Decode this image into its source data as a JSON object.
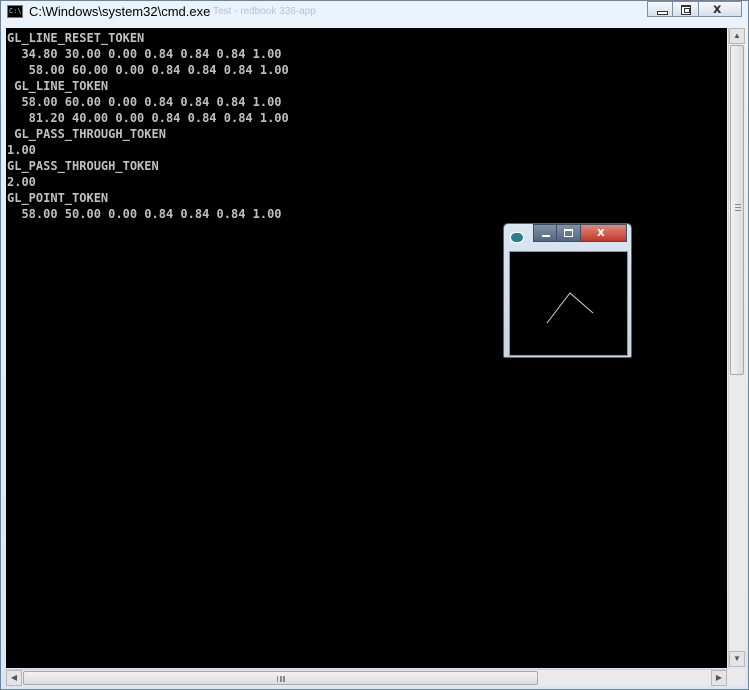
{
  "window": {
    "title": "C:\\Windows\\system32\\cmd.exe",
    "icon_text": "C:\\",
    "background_title": "Test - redbook 336-app"
  },
  "console": {
    "text_color": "#c0c0c0",
    "background": "#000000",
    "lines": [
      "GL_LINE_RESET_TOKEN",
      "  34.80 30.00 0.00 0.84 0.84 0.84 1.00",
      "   58.00 60.00 0.00 0.84 0.84 0.84 1.00",
      " GL_LINE_TOKEN",
      "  58.00 60.00 0.00 0.84 0.84 0.84 1.00",
      "   81.20 40.00 0.00 0.84 0.84 0.84 1.00",
      " GL_PASS_THROUGH_TOKEN",
      "1.00",
      "GL_PASS_THROUGH_TOKEN",
      "2.00",
      "GL_POINT_TOKEN",
      "  58.00 50.00 0.00 0.84 0.84 0.84 1.00"
    ]
  },
  "icons": {
    "minimize": "minimize-icon",
    "maximize": "maximize-icon",
    "close": "close-icon",
    "scroll_up": "arrow-up-icon",
    "scroll_down": "arrow-down-icon",
    "scroll_left": "arrow-left-icon",
    "scroll_right": "arrow-right-icon"
  },
  "scrollbar_glyphs": {
    "up": "▲",
    "down": "▼",
    "left": "◀",
    "right": "▶"
  },
  "gl_window": {
    "close_glyph": "x",
    "line_color": "#d6d6d6"
  }
}
